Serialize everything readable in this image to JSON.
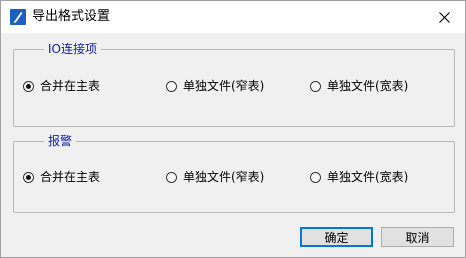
{
  "window": {
    "title": "导出格式设置",
    "icons": {
      "app": "app-icon",
      "close": "close-icon"
    }
  },
  "groups": [
    {
      "title": "IO连接项",
      "options": [
        {
          "label": "合并在主表",
          "checked": true
        },
        {
          "label": "单独文件(窄表)",
          "checked": false
        },
        {
          "label": "单独文件(宽表)",
          "checked": false
        }
      ]
    },
    {
      "title": "报警",
      "options": [
        {
          "label": "合并在主表",
          "checked": true
        },
        {
          "label": "单独文件(窄表)",
          "checked": false
        },
        {
          "label": "单独文件(宽表)",
          "checked": false
        }
      ]
    }
  ],
  "buttons": {
    "ok": "确定",
    "cancel": "取消"
  },
  "colors": {
    "group_title": "#0d1f9e",
    "default_button_border": "#0078d7",
    "background": "#f0f0f0"
  }
}
